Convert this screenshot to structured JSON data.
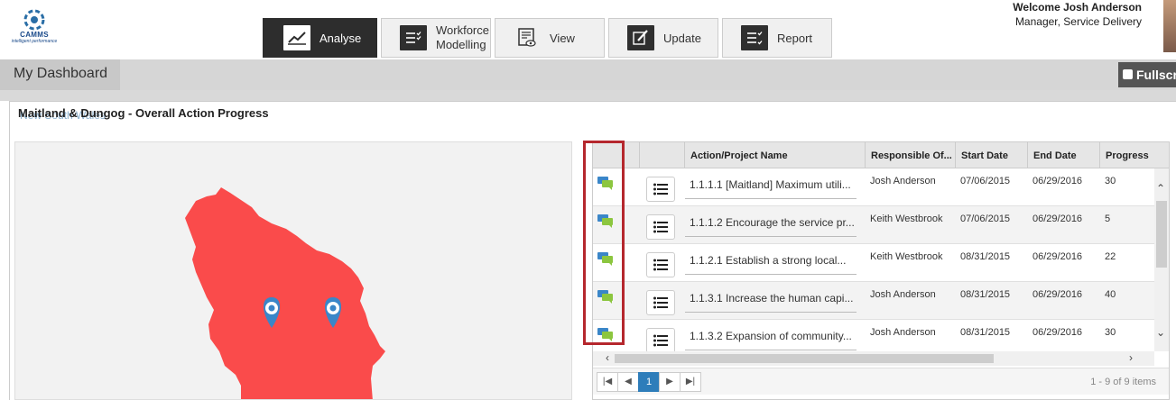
{
  "header": {
    "logo_text": "CAMMS",
    "logo_tagline": "intelligent performance",
    "user_greeting": "Welcome Josh Anderson",
    "user_role": "Manager, Service Delivery"
  },
  "nav": [
    {
      "label": "Analyse",
      "icon": "chart-line-icon",
      "active": true
    },
    {
      "label": "Workforce",
      "label2": "Modelling",
      "icon": "checklist-icon"
    },
    {
      "label": "View",
      "icon": "view-document-icon"
    },
    {
      "label": "Update",
      "icon": "edit-pen-icon"
    },
    {
      "label": "Report",
      "icon": "report-checklist-icon"
    }
  ],
  "dashboard": {
    "tab_label": "My Dashboard",
    "fullscreen_label": "Fullscr"
  },
  "panel": {
    "title": "Maitland & Dungog - Overall Action Progress",
    "subtitle": "New South Wales"
  },
  "grid": {
    "columns": [
      "Action/Project Name",
      "Responsible Of...",
      "Start Date",
      "End Date",
      "Progress"
    ],
    "rows": [
      {
        "name": "1.1.1.1 [Maitland] Maximum utili...",
        "responsible": "Josh Anderson",
        "start": "07/06/2015",
        "end": "06/29/2016",
        "progress": "30"
      },
      {
        "name": "1.1.1.2 Encourage the service pr...",
        "responsible": "Keith Westbrook",
        "start": "07/06/2015",
        "end": "06/29/2016",
        "progress": "5"
      },
      {
        "name": "1.1.2.1 Establish a strong local...",
        "responsible": "Keith Westbrook",
        "start": "08/31/2015",
        "end": "06/29/2016",
        "progress": "22"
      },
      {
        "name": "1.1.3.1 Increase the human capi...",
        "responsible": "Josh Anderson",
        "start": "08/31/2015",
        "end": "06/29/2016",
        "progress": "40"
      },
      {
        "name": "1.1.3.2 Expansion of community...",
        "responsible": "Josh Anderson",
        "start": "08/31/2015",
        "end": "06/29/2016",
        "progress": "30"
      }
    ],
    "pager": {
      "current_page": "1",
      "info": "1 - 9 of 9 items"
    }
  },
  "colors": {
    "map_region": "#fa4b4b",
    "pin": "#3a86c8",
    "highlight": "#b5272d",
    "active_nav": "#2d2d2d"
  }
}
